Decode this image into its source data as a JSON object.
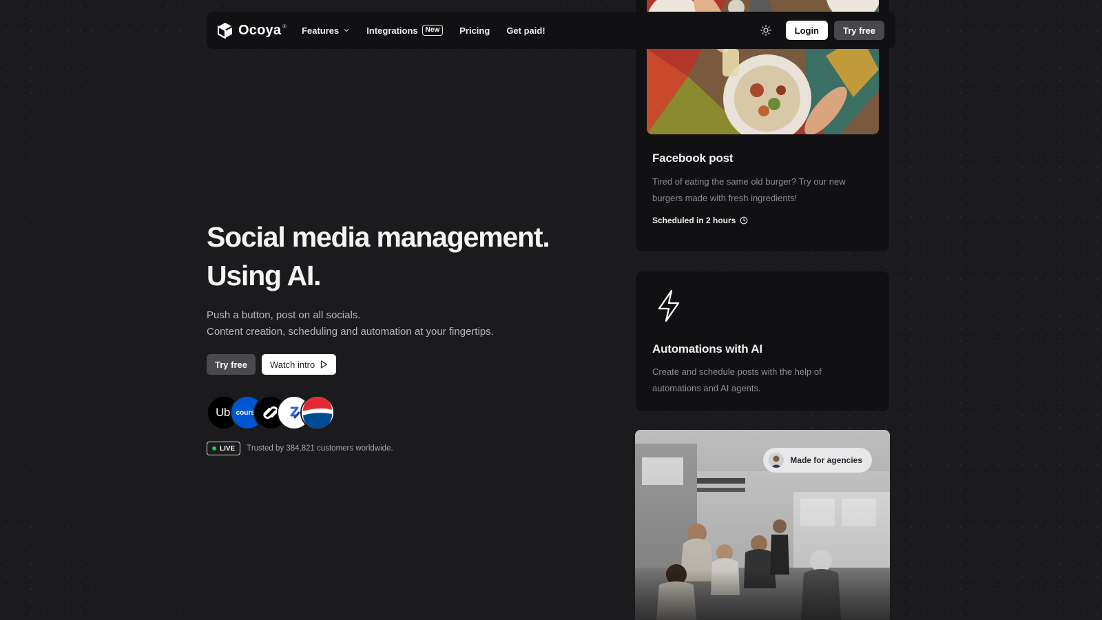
{
  "nav": {
    "brand": "Ocoya",
    "brand_mark": "®",
    "links": [
      {
        "label": "Features"
      },
      {
        "label": "Integrations",
        "badge": "New"
      },
      {
        "label": "Pricing"
      },
      {
        "label": "Get paid!"
      }
    ],
    "login_label": "Login",
    "try_free_label": "Try free"
  },
  "hero": {
    "title_line1": "Social media management.",
    "title_line2": "Using AI.",
    "subtitle_line1": "Push a button, post on all socials.",
    "subtitle_line2": "Content creation, scheduling and automation at your fingertips.",
    "try_free_label": "Try free",
    "watch_intro_label": "Watch intro",
    "customer_logos": [
      {
        "name": "Uber",
        "text": "Ube",
        "bg": "#000000",
        "fg": "#ffffff"
      },
      {
        "name": "Coursera",
        "text": "course",
        "bg": "#0056d2",
        "fg": "#ffffff"
      },
      {
        "name": "Squarespace",
        "text": "",
        "bg": "#000000",
        "fg": "#ffffff"
      },
      {
        "name": "Zapier-like",
        "text": "",
        "bg": "#ffffff",
        "fg": "#1d4ed8"
      },
      {
        "name": "Pepsi",
        "text": "",
        "bg": "#ffffff",
        "fg": "#e32934"
      }
    ],
    "live_label": "LIVE",
    "trust_text": "Trusted by 384,821 customers worldwide."
  },
  "cards": {
    "facebook": {
      "title": "Facebook post",
      "description": "Tired of eating the same old burger? Try our new burgers made with fresh ingredients!",
      "schedule": "Scheduled in 2 hours"
    },
    "automations": {
      "title": "Automations with AI",
      "description": "Create and schedule posts with the help of automations and AI agents."
    },
    "agencies": {
      "pill_label": "Made for agencies"
    }
  },
  "colors": {
    "background": "#1b1b1d",
    "card": "#111113",
    "live_dot": "#22c55e"
  }
}
